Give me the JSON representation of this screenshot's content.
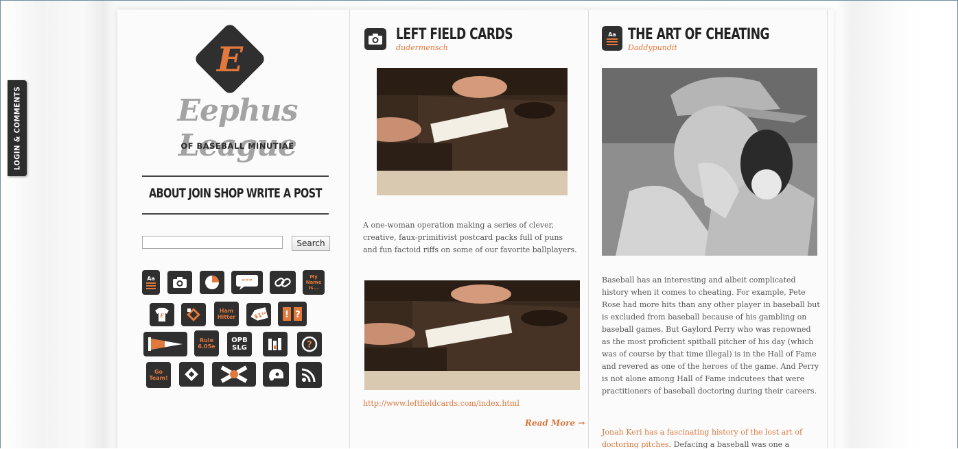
{
  "login_tab": {
    "label": "LOGIN & COMMENTS"
  },
  "site": {
    "logo_letter": "E",
    "title": "Eephus League",
    "subtitle": "OF BASEBALL MINUTIAE"
  },
  "nav": {
    "items": [
      {
        "label": "ABOUT"
      },
      {
        "label": "JOIN"
      },
      {
        "label": "SHOP"
      },
      {
        "label": "WRITE A POST"
      }
    ]
  },
  "search": {
    "value": "",
    "button_label": "Search"
  },
  "category_icons": {
    "my_name_is": "My Name Is...",
    "ham_hitter": "Ham Hitter",
    "price_tag": "$1¹⁰",
    "quote": "“””",
    "rule": "Rule 6.05e",
    "opb": "OPB SLG",
    "go_team": "Go Team!",
    "text_icon": "Aa",
    "exclaim": "!",
    "question": "?",
    "shirt_letter": "E"
  },
  "colors": {
    "accent": "#e2783b",
    "icon_bg": "#2f2f2f",
    "link": "#d9783f"
  },
  "posts": [
    {
      "icon": "camera-icon",
      "title": "LEFT FIELD CARDS",
      "author": "dudermensch",
      "body": "A one-woman operation making a series of clever, creative, faux-primitivist postcard packs full of puns and fun factoid riffs on some of our favorite ballplayers.",
      "link": "http://www.leftfieldcards.com/index.html",
      "read_more": "Read More →"
    },
    {
      "icon": "text-icon",
      "icon_text": "Aa",
      "title": "THE ART OF CHEATING",
      "author": "Daddypundit",
      "body": "Baseball has an interesting and albeit complicated history when it comes to cheating. For example, Pete Rose had more hits than any other player in baseball but is excluded from baseball because of his gambling on baseball games. But Gaylord Perry who was renowned as the most proficient spitball pitcher of his day (which was of course by that time illegal) is in the Hall of Fame and revered as one of the heroes of the game. And Perry is not alone among Hall of Fame indcutees that were practitioners of baseball doctoring during their careers.",
      "link_text": "Jonah Keri has a fascinating history of the lost art of doctoring pitches",
      "after_link": ". Defacing a baseball was one a"
    }
  ]
}
